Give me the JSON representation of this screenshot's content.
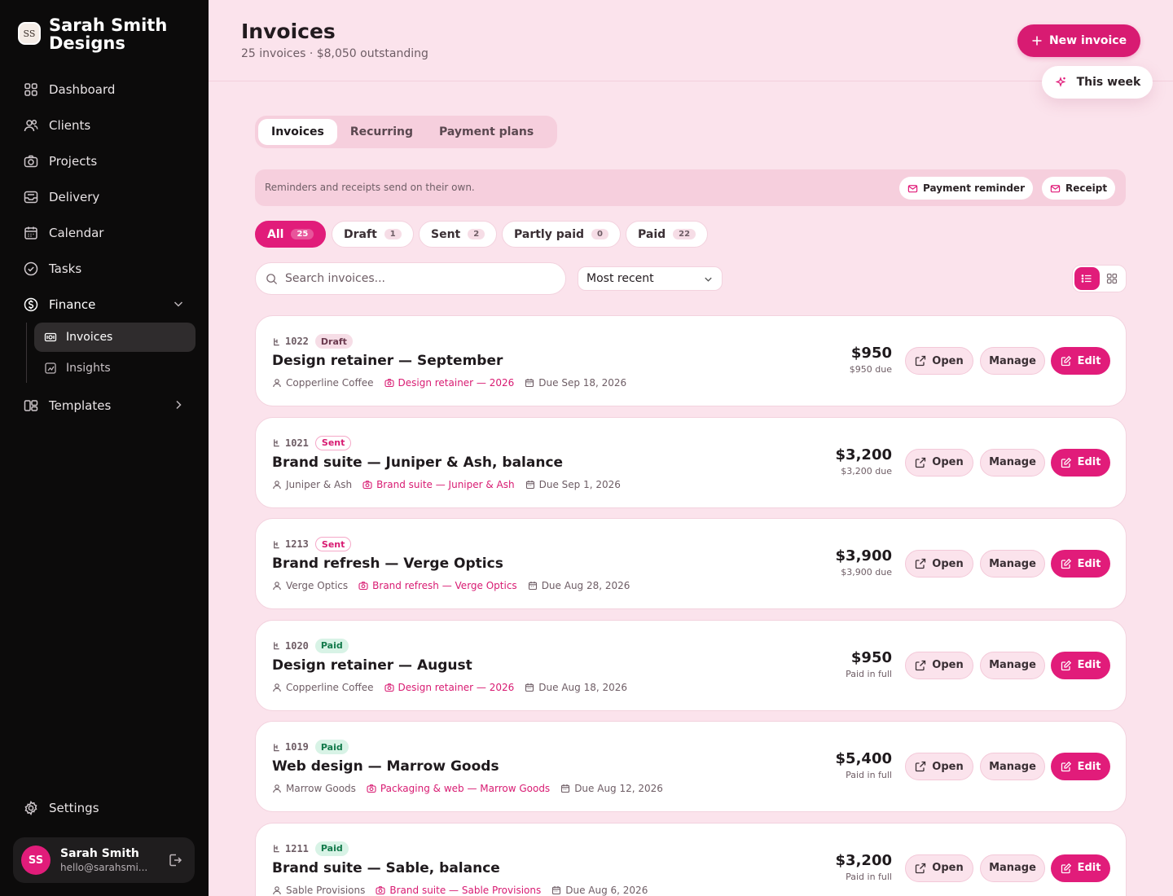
{
  "sidebar": {
    "brand_initials": "SS",
    "brand_name": "Sarah Smith Designs",
    "nav": [
      {
        "label": "Dashboard",
        "icon": "grid-icon"
      },
      {
        "label": "Clients",
        "icon": "users-icon"
      },
      {
        "label": "Projects",
        "icon": "camera-icon"
      },
      {
        "label": "Delivery",
        "icon": "inbox-icon"
      },
      {
        "label": "Calendar",
        "icon": "calendar-icon"
      },
      {
        "label": "Tasks",
        "icon": "check-circle-icon"
      },
      {
        "label": "Finance",
        "icon": "dollar-icon"
      }
    ],
    "finance_sub": [
      {
        "label": "Invoices",
        "icon": "receipt-icon"
      },
      {
        "label": "Insights",
        "icon": "chart-icon"
      }
    ],
    "templates_label": "Templates",
    "settings_label": "Settings",
    "user": {
      "initials": "SS",
      "name": "Sarah Smith",
      "email": "hello@sarahsmi..."
    }
  },
  "header": {
    "title": "Invoices",
    "subtitle": "25 invoices · $8,050 outstanding",
    "new_invoice_label": "New invoice",
    "this_week_label": "This week"
  },
  "tabs": [
    "Invoices",
    "Recurring",
    "Payment plans"
  ],
  "infobar": {
    "text": "Reminders and receipts send on their own.",
    "reminder_label": "Payment reminder",
    "receipt_label": "Receipt"
  },
  "filters": [
    {
      "label": "All",
      "count": "25"
    },
    {
      "label": "Draft",
      "count": "1"
    },
    {
      "label": "Sent",
      "count": "2"
    },
    {
      "label": "Partly paid",
      "count": "0"
    },
    {
      "label": "Paid",
      "count": "22"
    }
  ],
  "search": {
    "placeholder": "Search invoices..."
  },
  "sort": {
    "value": "Most recent"
  },
  "actions": {
    "open": "Open",
    "manage": "Manage",
    "edit": "Edit"
  },
  "colors": {
    "accent": "#e11c7a",
    "background": "#fbe3ec",
    "sidebar": "#0c0b0b"
  },
  "invoices": [
    {
      "number": "1022",
      "status": "Draft",
      "title": "Design retainer — September",
      "client": "Copperline Coffee",
      "project": "Design retainer — 2026",
      "due": "Due Sep 18, 2026",
      "amount": "$950",
      "amount_note": "$950 due"
    },
    {
      "number": "1021",
      "status": "Sent",
      "title": "Brand suite — Juniper & Ash, balance",
      "client": "Juniper & Ash",
      "project": "Brand suite — Juniper & Ash",
      "due": "Due Sep 1, 2026",
      "amount": "$3,200",
      "amount_note": "$3,200 due"
    },
    {
      "number": "1213",
      "status": "Sent",
      "title": "Brand refresh — Verge Optics",
      "client": "Verge Optics",
      "project": "Brand refresh — Verge Optics",
      "due": "Due Aug 28, 2026",
      "amount": "$3,900",
      "amount_note": "$3,900 due"
    },
    {
      "number": "1020",
      "status": "Paid",
      "title": "Design retainer — August",
      "client": "Copperline Coffee",
      "project": "Design retainer — 2026",
      "due": "Due Aug 18, 2026",
      "amount": "$950",
      "amount_note": "Paid in full"
    },
    {
      "number": "1019",
      "status": "Paid",
      "title": "Web design — Marrow Goods",
      "client": "Marrow Goods",
      "project": "Packaging & web — Marrow Goods",
      "due": "Due Aug 12, 2026",
      "amount": "$5,400",
      "amount_note": "Paid in full"
    },
    {
      "number": "1211",
      "status": "Paid",
      "title": "Brand suite — Sable, balance",
      "client": "Sable Provisions",
      "project": "Brand suite — Sable Provisions",
      "due": "Due Aug 6, 2026",
      "amount": "$3,200",
      "amount_note": "Paid in full"
    }
  ]
}
